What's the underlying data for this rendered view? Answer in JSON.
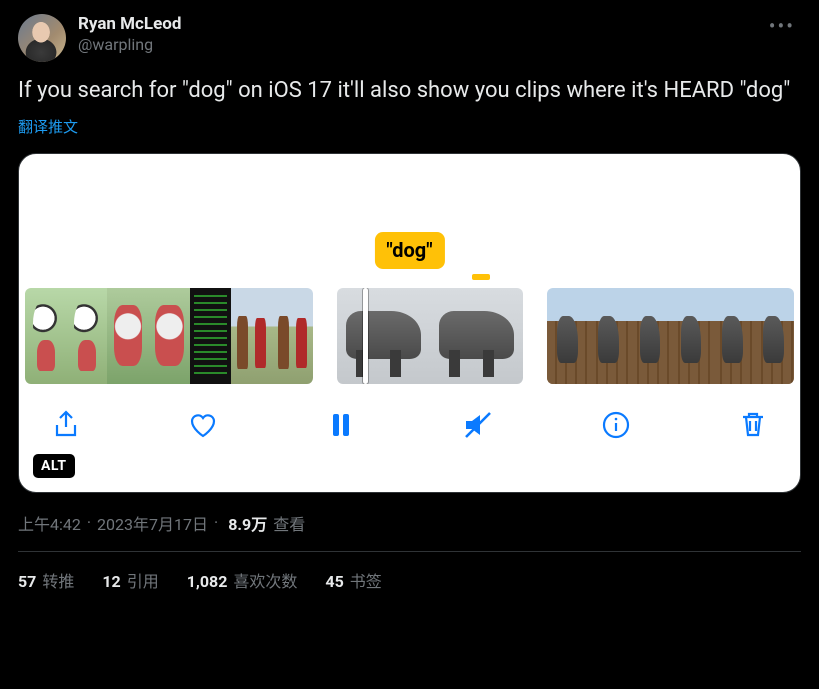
{
  "author": {
    "display_name": "Ryan McLeod",
    "handle": "@warpling"
  },
  "body_text": "If you search for \"dog\" on iOS 17 it'll also show you clips where it's HEARD \"dog\"",
  "translate_label": "翻译推文",
  "media": {
    "caption_label": "\"dog\"",
    "alt_badge": "ALT"
  },
  "meta": {
    "time": "上午4:42",
    "sep": " · ",
    "date": "2023年7月17日",
    "views_count": "8.9万",
    "views_label": "查看"
  },
  "stats": {
    "retweet_count": "57",
    "retweet_label": "转推",
    "quote_count": "12",
    "quote_label": "引用",
    "like_count": "1,082",
    "like_label": "喜欢次数",
    "bookmark_count": "45",
    "bookmark_label": "书签"
  }
}
